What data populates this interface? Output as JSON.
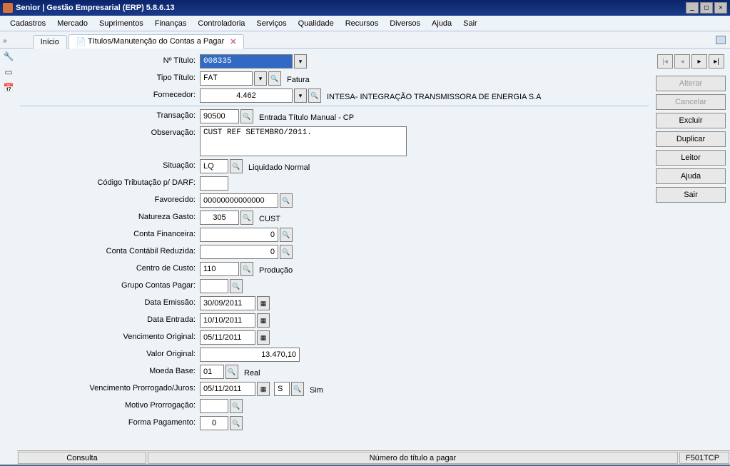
{
  "window": {
    "title": "Senior | Gestão Empresarial (ERP) 5.8.6.13"
  },
  "menu": [
    "Cadastros",
    "Mercado",
    "Suprimentos",
    "Finanças",
    "Controladoria",
    "Serviços",
    "Qualidade",
    "Recursos",
    "Diversos",
    "Ajuda",
    "Sair"
  ],
  "tabs": {
    "home": "Início",
    "active": "Títulos/Manutenção do Contas a Pagar"
  },
  "sidebtn": {
    "alterar": "Alterar",
    "cancelar": "Cancelar",
    "excluir": "Excluir",
    "duplicar": "Duplicar",
    "leitor": "Leitor",
    "ajuda": "Ajuda",
    "sair": "Sair"
  },
  "labels": {
    "ntitulo": "Nº Título:",
    "tipotitulo": "Tipo Título:",
    "fornecedor": "Fornecedor:",
    "transacao": "Transação:",
    "observacao": "Observação:",
    "situacao": "Situação:",
    "codtrib": "Código Tributação p/ DARF:",
    "favorecido": "Favorecido:",
    "natgasto": "Natureza Gasto:",
    "contafin": "Conta Financeira:",
    "contacont": "Conta Contábil Reduzida:",
    "ccusto": "Centro de Custo:",
    "grupocp": "Grupo Contas Pagar:",
    "demissao": "Data Emissão:",
    "dentrada": "Data Entrada:",
    "vencorig": "Vencimento Original:",
    "valororig": "Valor Original:",
    "moeda": "Moeda Base:",
    "vencpror": "Vencimento Prorrogado/Juros:",
    "motivo": "Motivo Prorrogação:",
    "formapag": "Forma Pagamento:"
  },
  "values": {
    "ntitulo": "008335",
    "tipotitulo": "FAT",
    "tipotitulo_desc": "Fatura",
    "fornecedor": "4.462",
    "fornecedor_desc": "INTESA- INTEGRAÇÃO TRANSMISSORA DE ENERGIA S.A",
    "transacao": "90500",
    "transacao_desc": "Entrada Título Manual - CP",
    "observacao": "CUST REF SETEMBRO/2011.",
    "situacao": "LQ",
    "situacao_desc": "Liquidado Normal",
    "codtrib": "",
    "favorecido": "00000000000000",
    "natgasto": "305",
    "natgasto_desc": "CUST",
    "contafin": "0",
    "contacont": "0",
    "ccusto": "110",
    "ccusto_desc": "Produção",
    "grupocp": "",
    "demissao": "30/09/2011",
    "dentrada": "10/10/2011",
    "vencorig": "05/11/2011",
    "valororig": "13.470,10",
    "moeda": "01",
    "moeda_desc": "Real",
    "vencpror": "05/11/2011",
    "vencpror_flag": "S",
    "vencpror_desc": "Sim",
    "motivo": "",
    "formapag": "0"
  },
  "status": {
    "left": "Consulta",
    "center": "Número do título a pagar",
    "right": "F501TCP"
  }
}
